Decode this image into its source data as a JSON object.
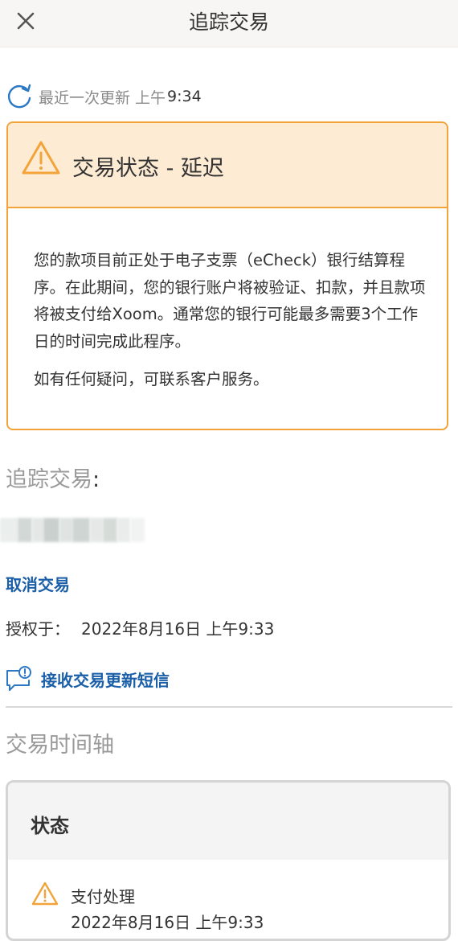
{
  "header": {
    "title": "追踪交易",
    "close_icon": "close-icon"
  },
  "refresh": {
    "icon": "refresh-icon",
    "label": "最近一次更新 上午",
    "time": "9:34"
  },
  "alert": {
    "icon": "warning-icon",
    "accent_color": "#f2a33a",
    "title": "交易状态 - 延迟",
    "body": "您的款项目前正处于电子支票（eCheck）银行结算程序。在此期间，您的银行账户将被验证、扣款，并且款项将被支付给Xoom。通常您的银行可能最多需要3个工作日的时间完成此程序。",
    "contact": "如有任何疑问，可联系客户服务。"
  },
  "tracking": {
    "label": "追踪交易",
    "colon": ":"
  },
  "actions": {
    "cancel_label": "取消交易",
    "link_color": "#1a5fa8",
    "authorized_label": "授权于：",
    "authorized_value": "2022年8月16日 上午9:33",
    "sms_icon": "message-icon",
    "sms_label": "接收交易更新短信"
  },
  "timeline": {
    "heading": "交易时间轴",
    "status_title": "状态",
    "item_icon": "warning-icon",
    "item_label": "支付处理",
    "item_time": "2022年8月16日 上午9:33"
  }
}
